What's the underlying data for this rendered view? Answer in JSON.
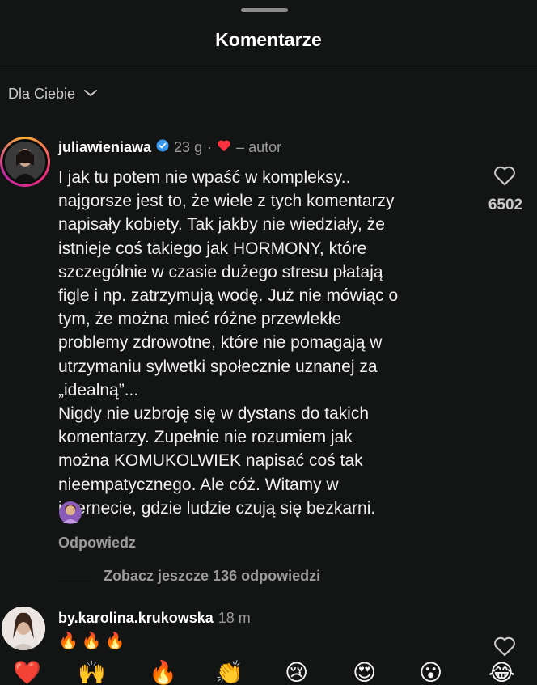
{
  "sheet": {
    "title": "Komentarze"
  },
  "filter": {
    "label": "Dla Ciebie",
    "icon": "chevron-down-icon"
  },
  "comments": [
    {
      "username": "juliawieniawa",
      "verified": true,
      "time": "23 g",
      "dot": "·",
      "author_tag": "– autor",
      "liked_by_author_icon": "red-heart-icon",
      "text_1": "I jak tu potem nie wpaść w kompleksy..\nnajgorsze jest to, że wiele z tych komentarzy\nnapisały kobiety. Tak jakby nie wiedziały, że\nistnieje coś takiego jak HORMONY, które\nszczególnie w czasie dużego stresu płatają\nfigle i np. zatrzymują wodę. Już nie mówiąc o\ntym, że można  mieć różne przewlekłe\nproblemy zdrowotne, które nie pomagają w\nutrzymaniu sylwetki społecznie uznanej za\n„idealną”...",
      "text_2": "Nigdy nie uzbroję się w dystans do takich\nkomentarzy. Zupełnie nie rozumiem jak\nmożna KOMUKOLWIEK napisać coś tak\nnieempatycznego. Ale cóż. Witamy w\ninternecie, gdzie ludzie czują się bezkarni.",
      "emoji": "🙎‍♀️",
      "reply_label": "Odpowiedz",
      "like_count": "6502",
      "view_replies": "Zobacz jeszcze 136 odpowiedzi"
    },
    {
      "username": "by.karolina.krukowska",
      "time": "18 m",
      "text": "🔥🔥🔥"
    }
  ],
  "reactions": [
    "❤️",
    "🙌",
    "🔥",
    "👏",
    "😢",
    "😍",
    "😮",
    "😂"
  ],
  "colors": {
    "background": "#131414",
    "muted": "#9b9b9b",
    "heart": "#ff3040",
    "verified": "#3897f0"
  }
}
